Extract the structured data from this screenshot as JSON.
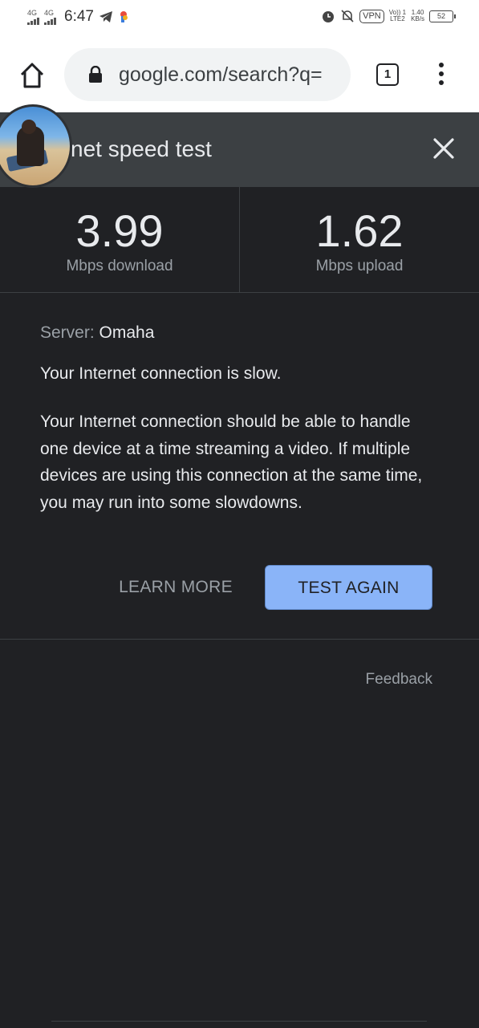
{
  "status_bar": {
    "network_1": "4G",
    "network_2": "4G",
    "time": "6:47",
    "vpn": "VPN",
    "volte_top": "Vo)) 1",
    "volte_bottom": "LTE2",
    "speed_value": "1.40",
    "speed_unit": "KB/s",
    "battery": "52"
  },
  "browser": {
    "url": "google.com/search?q=",
    "tab_count": "1"
  },
  "speed_test": {
    "title": "net speed test",
    "download": {
      "value": "3.99",
      "label": "Mbps download"
    },
    "upload": {
      "value": "1.62",
      "label": "Mbps upload"
    },
    "server_label": "Server:",
    "server_name": "Omaha",
    "summary": "Your Internet connection is slow.",
    "description": "Your Internet connection should be able to handle one device at a time streaming a video. If multiple devices are using this connection at the same time, you may run into some slowdowns.",
    "learn_more": "LEARN MORE",
    "test_again": "TEST AGAIN",
    "feedback": "Feedback"
  },
  "colors": {
    "background": "#202124",
    "header": "#3c4043",
    "accent_button": "#8ab4f8",
    "text_primary": "#e8eaed",
    "text_secondary": "#9aa0a6"
  }
}
